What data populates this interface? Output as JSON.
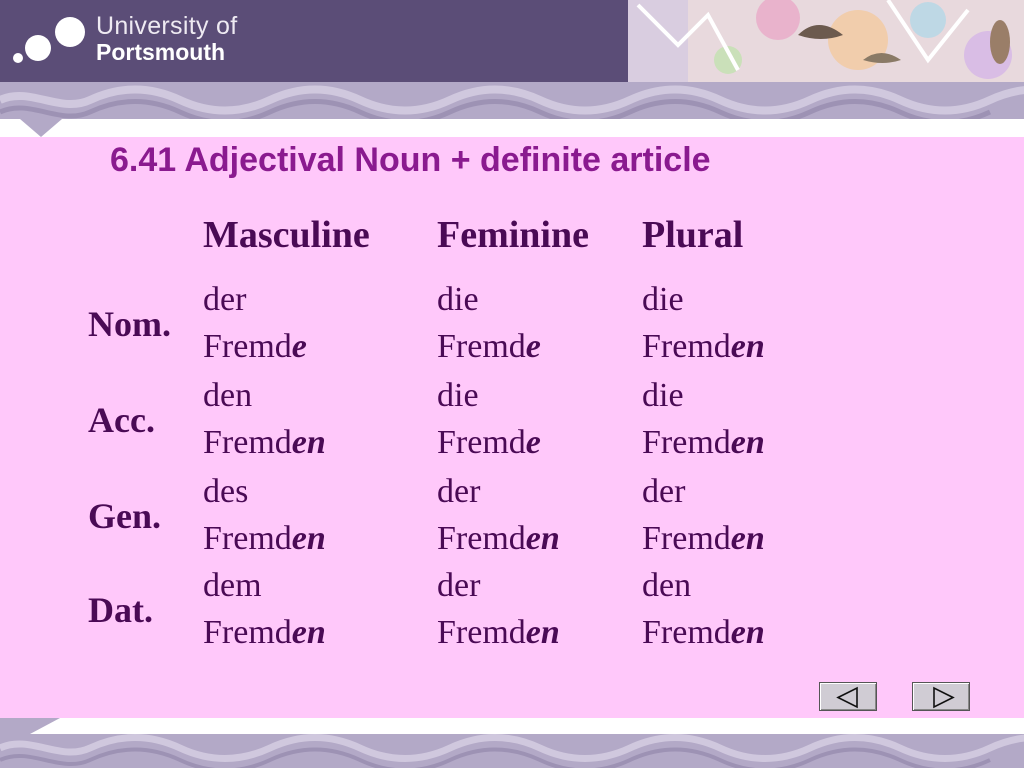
{
  "header": {
    "uni_name": "University of",
    "uni_city": "Portsmouth"
  },
  "title": "6.41 Adjectival Noun + definite article",
  "columns": [
    "Masculine",
    "Feminine",
    "Plural"
  ],
  "rows": [
    {
      "case": "Nom.",
      "cells": [
        {
          "article": "der",
          "stem": "Fremd",
          "ending": "e"
        },
        {
          "article": "die",
          "stem": "Fremd",
          "ending": "e"
        },
        {
          "article": "die",
          "stem": "Fremd",
          "ending": "en"
        }
      ]
    },
    {
      "case": "Acc.",
      "cells": [
        {
          "article": "den",
          "stem": "Fremd",
          "ending": "en"
        },
        {
          "article": "die",
          "stem": "Fremd",
          "ending": "e"
        },
        {
          "article": "die",
          "stem": "Fremd",
          "ending": "en"
        }
      ]
    },
    {
      "case": "Gen.",
      "cells": [
        {
          "article": "des",
          "stem": "Fremd",
          "ending": "en"
        },
        {
          "article": "der",
          "stem": "Fremd",
          "ending": "en"
        },
        {
          "article": "der",
          "stem": "Fremd",
          "ending": "en"
        }
      ]
    },
    {
      "case": "Dat.",
      "cells": [
        {
          "article": "dem",
          "stem": "Fremd",
          "ending": "en"
        },
        {
          "article": "der",
          "stem": "Fremd",
          "ending": "en"
        },
        {
          "article": "den",
          "stem": "Fremd",
          "ending": "en"
        }
      ]
    }
  ],
  "colors": {
    "title": "#8a1a8f",
    "text": "#4a0a55",
    "background": "#ffc8fa",
    "header": "#5b4d77"
  },
  "nav": {
    "prev_icon": "triangle-left-icon",
    "next_icon": "triangle-right-icon"
  }
}
